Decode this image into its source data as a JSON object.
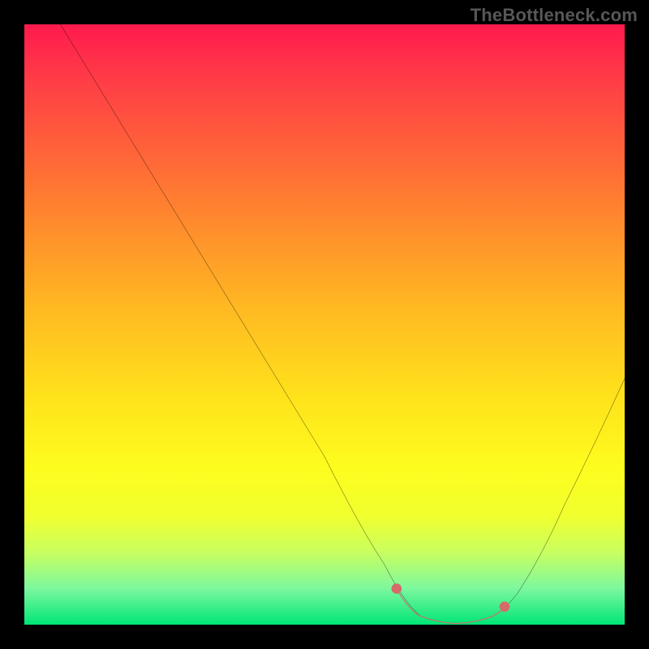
{
  "watermark": "TheBottleneck.com",
  "chart_data": {
    "type": "line",
    "title": "",
    "xlabel": "",
    "ylabel": "",
    "xlim": [
      0,
      100
    ],
    "ylim": [
      0,
      100
    ],
    "x": [
      6,
      10,
      15,
      20,
      25,
      30,
      35,
      40,
      45,
      50,
      55,
      60,
      62,
      66,
      70,
      74,
      78,
      80,
      85,
      90,
      95,
      100
    ],
    "values": [
      100,
      92,
      84,
      76,
      68,
      60,
      52,
      44,
      36,
      28,
      20,
      10,
      5,
      1,
      0,
      0,
      1,
      3,
      10,
      20,
      30,
      41
    ],
    "highlight_region": {
      "x_start": 62,
      "x_end": 80
    },
    "colors": {
      "curve": "#000000",
      "highlight": "#d46a6a"
    }
  }
}
